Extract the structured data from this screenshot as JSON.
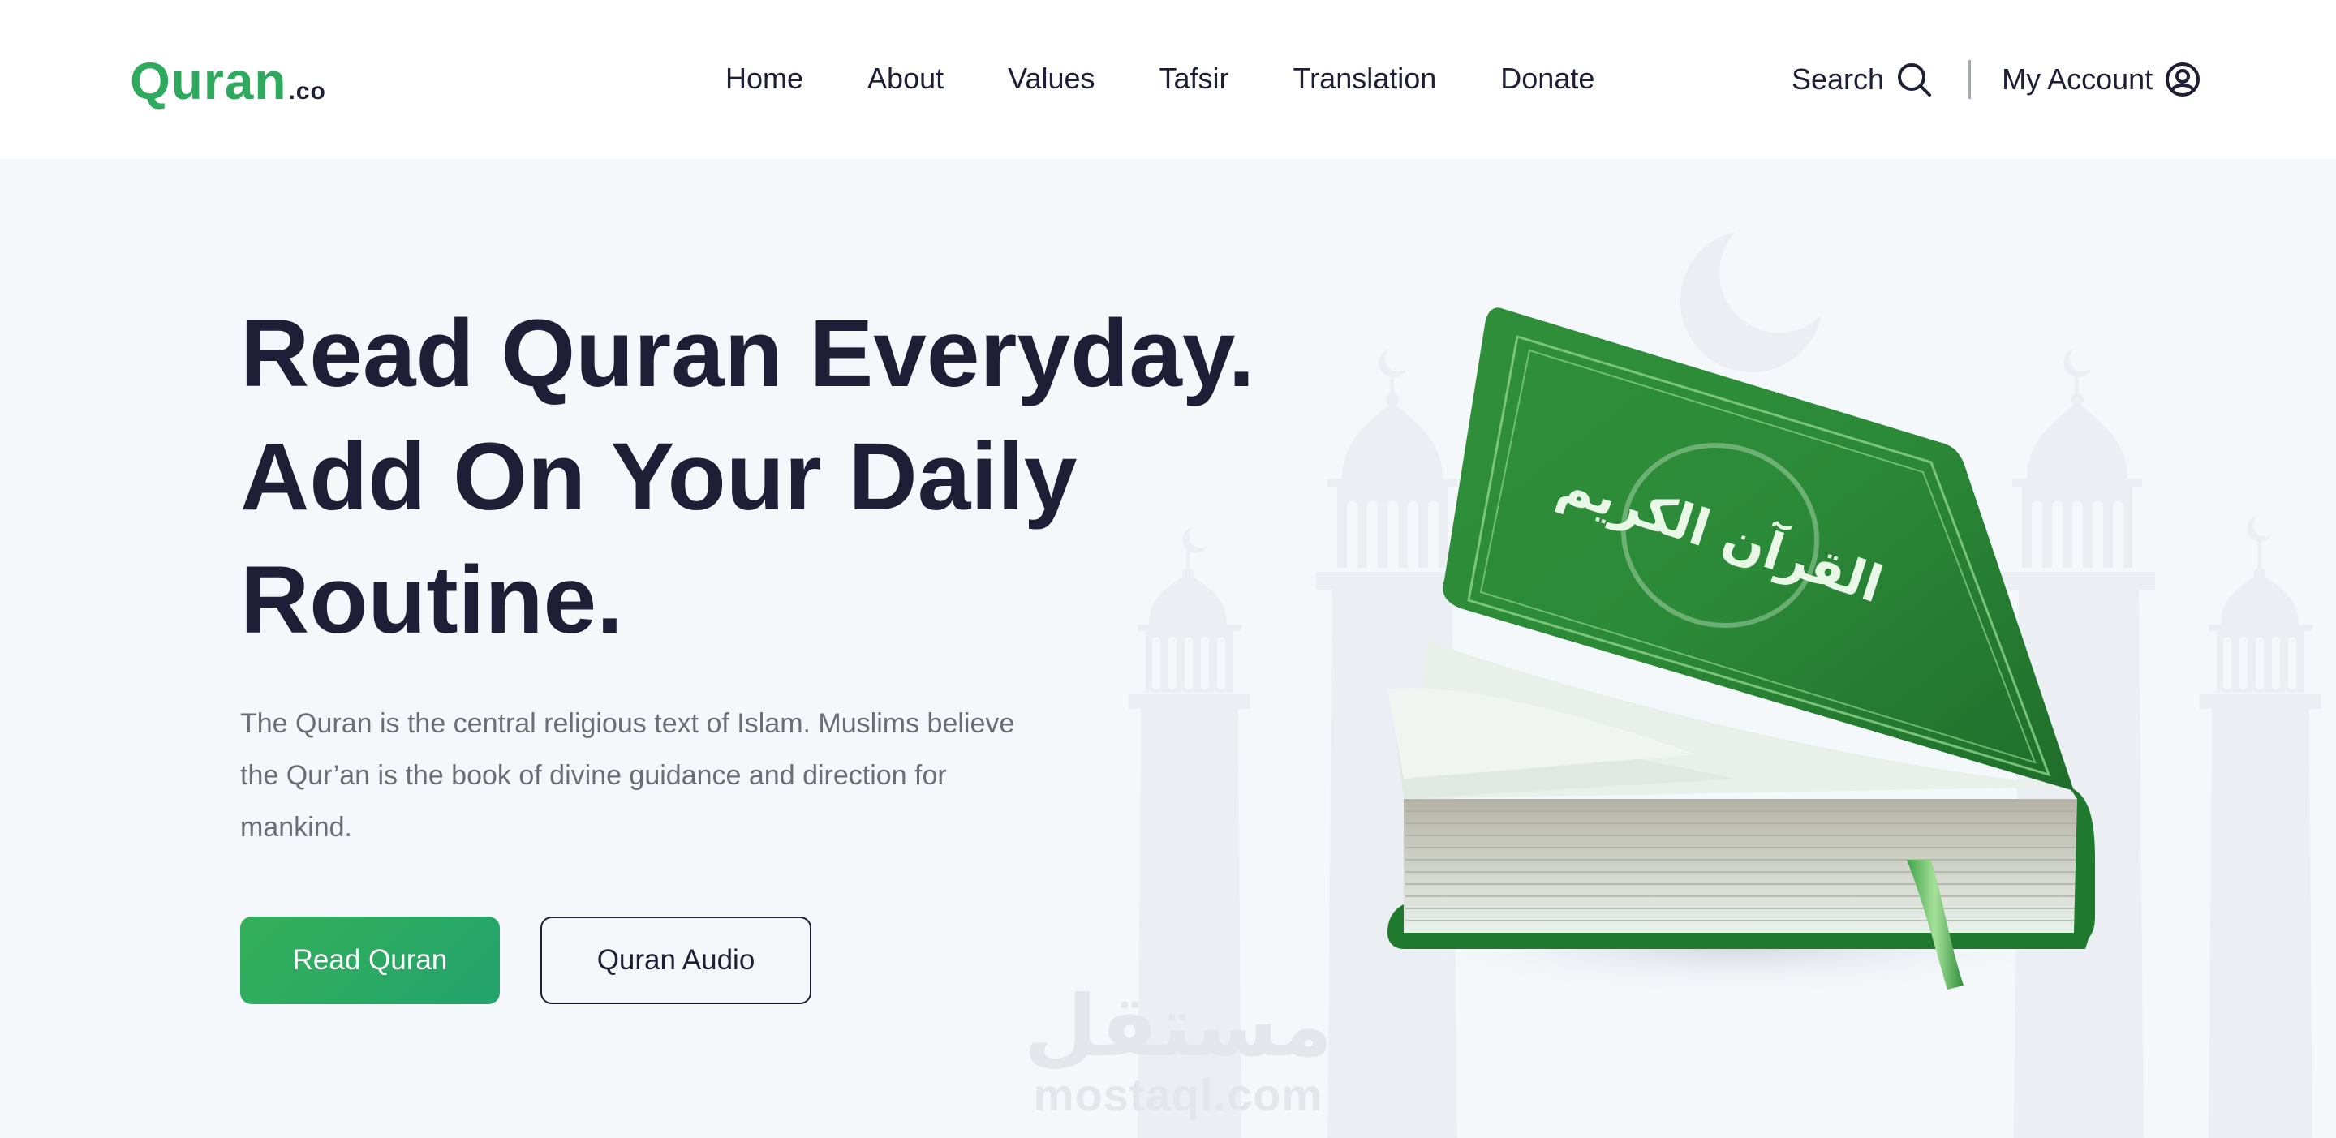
{
  "header": {
    "logo": {
      "name": "Quran",
      "tld": ".co"
    },
    "nav": [
      {
        "label": "Home"
      },
      {
        "label": "About"
      },
      {
        "label": "Values"
      },
      {
        "label": "Tafsir"
      },
      {
        "label": "Translation"
      },
      {
        "label": "Donate"
      }
    ],
    "search_label": "Search",
    "account_label": "My Account",
    "icons": {
      "search": "search-icon",
      "account": "user-circle-icon"
    }
  },
  "hero": {
    "headline_lines": [
      "Read Quran Everyday.",
      "Add On Your Daily",
      "Routine."
    ],
    "description": "The Quran is the central religious text of Islam. Muslims believe the Qur’an is the book of divine guidance and direction for mankind.",
    "primary_button": "Read Quran",
    "secondary_button": "Quran Audio",
    "illustration": "quran-book-illustration",
    "book_calligraphy": "القرآن الكريم"
  },
  "watermark": {
    "arabic": "مستقل",
    "latin": "mostaql.com"
  },
  "colors": {
    "brand_green": "#2eaa5f",
    "button_green": "#27a665",
    "text_dark": "#1e1f36",
    "text_muted": "#6b6e76",
    "hero_bg": "#f4f8fb",
    "header_bg": "#ffffff",
    "art_silhouette": "#ebeff4"
  }
}
